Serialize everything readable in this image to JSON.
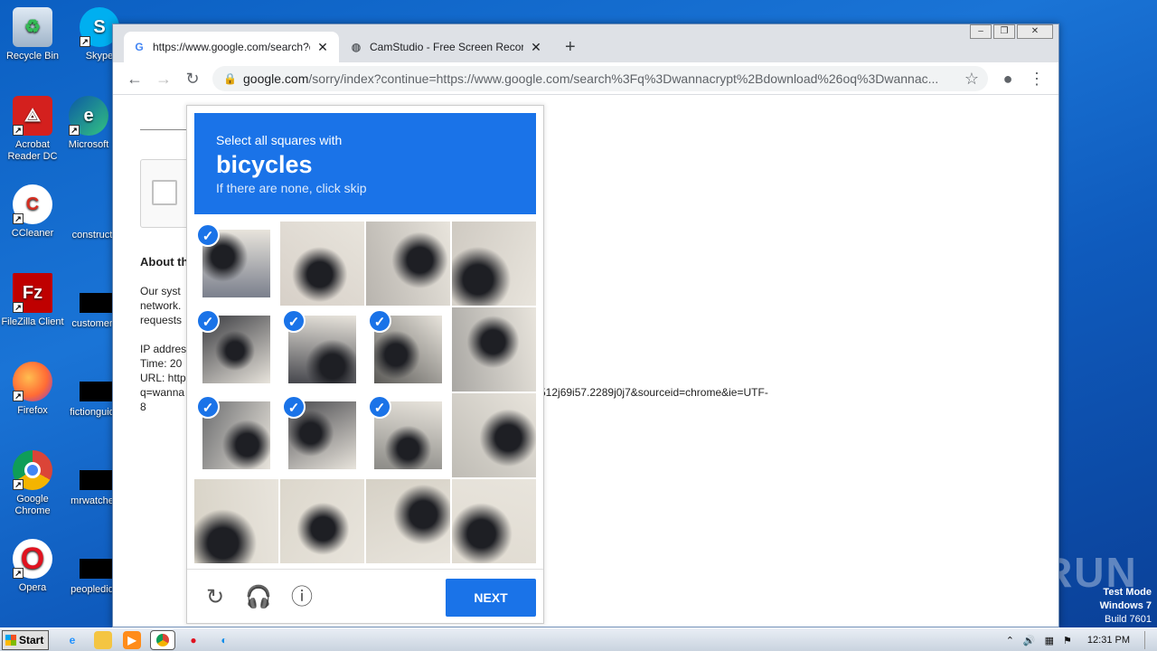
{
  "desktop": {
    "icons": [
      {
        "label": "Recycle Bin"
      },
      {
        "label": "Skype"
      },
      {
        "label": "Acrobat Reader DC"
      },
      {
        "label": "Microsoft"
      },
      {
        "label": "CCleaner"
      },
      {
        "label": "construct"
      },
      {
        "label": "FileZilla Client"
      },
      {
        "label": "customer"
      },
      {
        "label": "Firefox"
      },
      {
        "label": "fictionguid"
      },
      {
        "label": "Google Chrome"
      },
      {
        "label": "mrwatche"
      },
      {
        "label": "Opera"
      },
      {
        "label": "peopledid"
      }
    ]
  },
  "browser": {
    "tabs": [
      {
        "title": "https://www.google.com/search?q=",
        "close": "✕"
      },
      {
        "title": "CamStudio - Free Screen Recording",
        "close": "✕"
      }
    ],
    "new_tab": "+",
    "window_controls": [
      "‒",
      "❐",
      "✕"
    ],
    "url_host": "google.com",
    "url_rest": "/sorry/index?continue=https://www.google.com/search%3Fq%3Dwannacrypt%2Bdownload%26oq%3Dwannac..."
  },
  "page": {
    "about": "About th",
    "para": [
      "Our syst",
      "network.",
      "requests"
    ],
    "ip_lines": [
      "IP addres",
      "Time: 20",
      "URL: http",
      "q=wanna",
      "8"
    ],
    "url_tail": "512j69i57.2289j0j7&sourceid=chrome&ie=UTF-"
  },
  "captcha": {
    "line1": "Select all squares with",
    "keyword": "bicycles",
    "line3": "If there are none, click skip",
    "tiles": [
      {
        "selected": true
      },
      {
        "selected": false
      },
      {
        "selected": false
      },
      {
        "selected": false
      },
      {
        "selected": true
      },
      {
        "selected": true
      },
      {
        "selected": true
      },
      {
        "selected": false
      },
      {
        "selected": true
      },
      {
        "selected": true
      },
      {
        "selected": true
      },
      {
        "selected": false
      },
      {
        "selected": false
      },
      {
        "selected": false
      },
      {
        "selected": false
      },
      {
        "selected": false
      }
    ],
    "next_label": "NEXT"
  },
  "taskbar": {
    "start_label": "Start",
    "clock": "12:31 PM"
  },
  "overlay": {
    "watermark": "ANY RUN",
    "testmode": [
      "Test Mode",
      "Windows 7",
      "Build 7601"
    ]
  }
}
